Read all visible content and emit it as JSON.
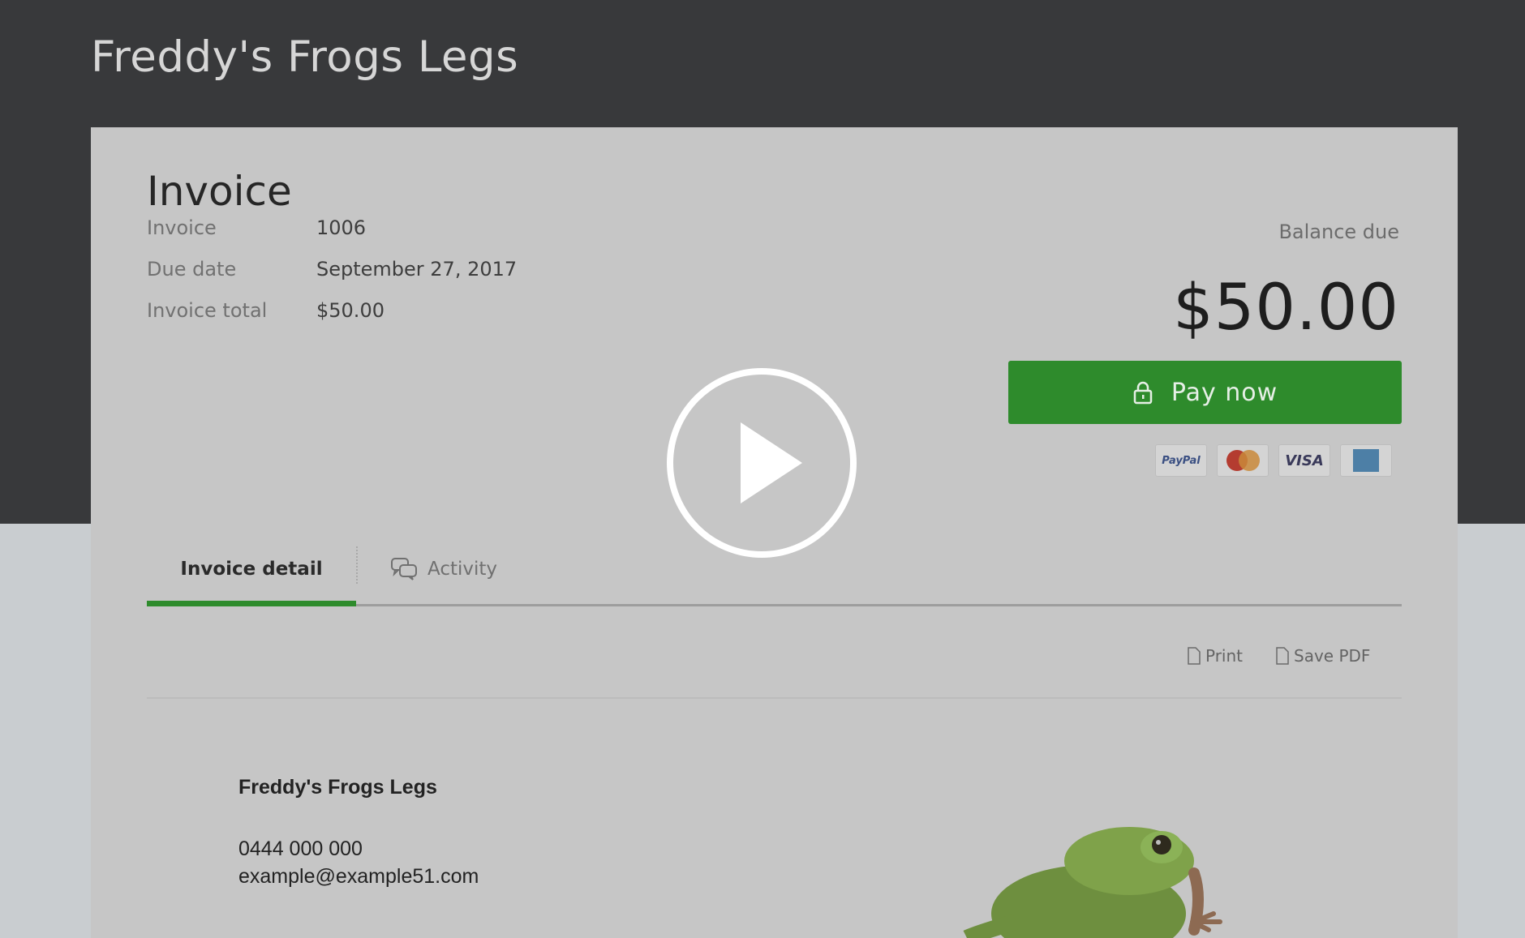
{
  "header": {
    "company_name": "Freddy's Frogs Legs"
  },
  "invoice": {
    "heading": "Invoice",
    "fields": [
      {
        "label": "Invoice",
        "value": "1006"
      },
      {
        "label": "Due date",
        "value": "September 27, 2017"
      },
      {
        "label": "Invoice total",
        "value": "$50.00"
      }
    ],
    "balance_label": "Balance due",
    "balance_amount": "$50.00",
    "pay_button": "Pay now",
    "payment_methods": [
      "PayPal",
      "MasterCard",
      "VISA",
      "American Express"
    ]
  },
  "tabs": [
    {
      "label": "Invoice detail",
      "active": true
    },
    {
      "label": "Activity",
      "active": false
    }
  ],
  "actions": {
    "print": "Print",
    "save_pdf": "Save PDF"
  },
  "business": {
    "name": "Freddy's Frogs Legs",
    "phone": "0444 000 000",
    "email": "example@example51.com"
  },
  "colors": {
    "accent": "#2e8b2c",
    "header_bg": "#38393b"
  },
  "icons": [
    "lock-icon",
    "chat-icon",
    "document-icon",
    "play-icon"
  ]
}
